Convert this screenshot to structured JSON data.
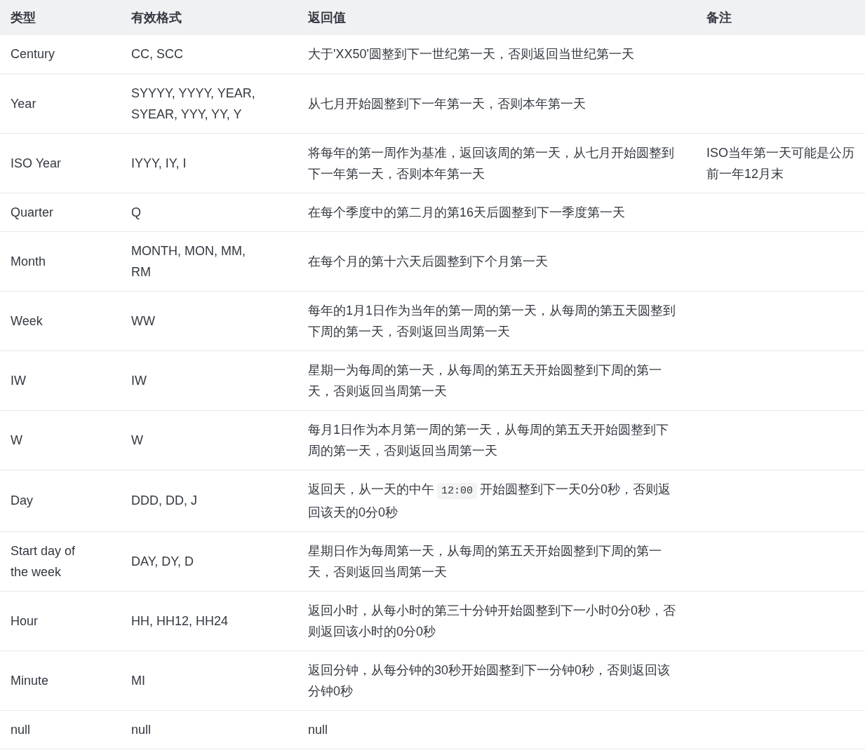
{
  "table": {
    "columns": [
      "类型",
      "有效格式",
      "返回值",
      "备注"
    ],
    "rows": [
      {
        "type": "Century",
        "formats": "CC, SCC",
        "return_value": [
          {
            "kind": "text",
            "text": "大于'XX50'圆整到下一世纪第一天，否则返回当世纪第一天"
          }
        ]
      },
      {
        "type": "Year",
        "formats": "SYYYY, YYYY, YEAR, SYEAR, YYY, YY, Y",
        "return_value": [
          {
            "kind": "text",
            "text": "从七月开始圆整到下一年第一天，否则本年第一天"
          }
        ]
      },
      {
        "type": "ISO Year",
        "formats": "IYYY, IY, I",
        "return_value": [
          {
            "kind": "text",
            "text": "将每年的第一周作为基准，返回该周的第一天，从七月开始圆整到下一年第一天，否则本年第一天"
          }
        ],
        "note": "ISO当年第一天可能是公历前一年12月末"
      },
      {
        "type": "Quarter",
        "formats": "Q",
        "return_value": [
          {
            "kind": "text",
            "text": "在每个季度中的第二月的第16天后圆整到下一季度第一天"
          }
        ]
      },
      {
        "type": "Month",
        "formats": "MONTH, MON, MM, RM",
        "return_value": [
          {
            "kind": "text",
            "text": "在每个月的第十六天后圆整到下个月第一天"
          }
        ]
      },
      {
        "type": "Week",
        "formats": "WW",
        "return_value": [
          {
            "kind": "text",
            "text": "每年的1月1日作为当年的第一周的第一天，从每周的第五天圆整到下周的第一天，否则返回当周第一天"
          }
        ]
      },
      {
        "type": "IW",
        "formats": "IW",
        "return_value": [
          {
            "kind": "text",
            "text": "星期一为每周的第一天，从每周的第五天开始圆整到下周的第一天，否则返回当周第一天"
          }
        ]
      },
      {
        "type": "W",
        "formats": "W",
        "return_value": [
          {
            "kind": "text",
            "text": "每月1日作为本月第一周的第一天，从每周的第五天开始圆整到下周的第一天，否则返回当周第一天"
          }
        ]
      },
      {
        "type": "Day",
        "formats": "DDD, DD, J",
        "return_value": [
          {
            "kind": "text",
            "text": "返回天，从一天的中午"
          },
          {
            "kind": "code",
            "text": "12:00"
          },
          {
            "kind": "text",
            "text": "开始圆整到下一天0分0秒，否则返回该天的0分0秒"
          }
        ]
      },
      {
        "type": "Start day of the week",
        "formats": "DAY, DY, D",
        "return_value": [
          {
            "kind": "text",
            "text": "星期日作为每周第一天，从每周的第五天开始圆整到下周的第一天，否则返回当周第一天"
          }
        ]
      },
      {
        "type": "Hour",
        "formats": "HH, HH12, HH24",
        "return_value": [
          {
            "kind": "text",
            "text": "返回小时，从每小时的第三十分钟开始圆整到下一小时0分0秒，否则返回该小时的0分0秒"
          }
        ]
      },
      {
        "type": "Minute",
        "formats": "MI",
        "return_value": [
          {
            "kind": "text",
            "text": "返回分钟，从每分钟的30秒开始圆整到下一分钟0秒，否则返回该分钟0秒"
          }
        ]
      },
      {
        "type": "null",
        "formats": "null",
        "return_value": [
          {
            "kind": "text",
            "text": "null"
          }
        ]
      }
    ]
  }
}
